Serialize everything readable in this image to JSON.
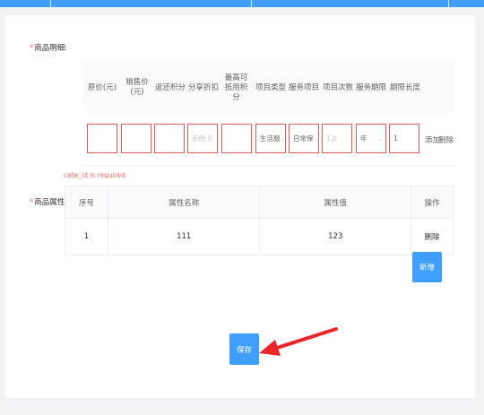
{
  "goods_detail": {
    "label": "商品明细:",
    "required_mark": "*",
    "columns": [
      "原价(元)",
      "销售价(元)",
      "返还积分",
      "分享折扣",
      "最高可抵用积分",
      "项目类型",
      "服务项目",
      "项目次数",
      "服务期限",
      "期限长度"
    ],
    "inputs": {
      "share_discount_placeholder": "示例:0.",
      "project_type_value": "生活服",
      "service_item_value": "日常保",
      "count_value": "1次",
      "period_value": "年",
      "length_value": "1"
    },
    "add_label": "添加",
    "delete_label": "删除",
    "error_text": "cate_id is required"
  },
  "goods_attr": {
    "label": "商品属性:",
    "required_mark": "*",
    "headers": [
      "序号",
      "属性名称",
      "属性值",
      "操作"
    ],
    "rows": [
      {
        "index": "1",
        "name": "111",
        "value": "123",
        "op": "删除"
      }
    ],
    "new_button": "新增"
  },
  "save_button": "保存",
  "colors": {
    "primary": "#409eff",
    "danger": "#f56c6c",
    "arrow": "#e8262a"
  }
}
